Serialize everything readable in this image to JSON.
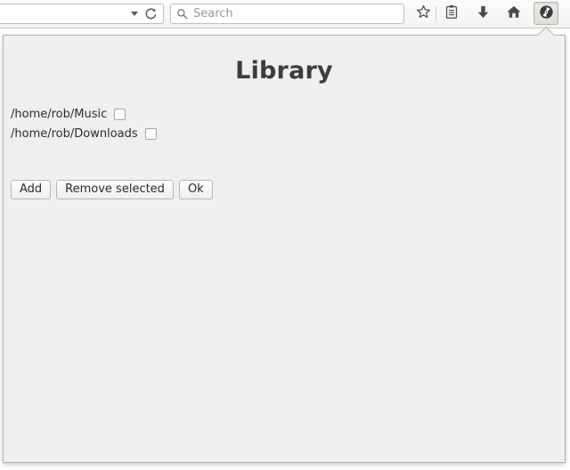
{
  "toolbar": {
    "urlbar": {
      "value": "",
      "placeholder": ""
    },
    "urlbar_dropdown_icon": "chevron-down-icon",
    "reload_icon": "reload-icon",
    "search": {
      "value": "",
      "placeholder": "Search",
      "icon": "search-icon"
    },
    "actions": [
      {
        "name": "bookmark-button",
        "icon": "star-icon",
        "active": false
      },
      {
        "name": "library-button",
        "icon": "library-icon",
        "active": false
      },
      {
        "name": "downloads-button",
        "icon": "download-arrow-icon",
        "active": false
      },
      {
        "name": "home-button",
        "icon": "home-icon",
        "active": false
      },
      {
        "name": "media-panel-button",
        "icon": "disc-icon",
        "active": true
      }
    ]
  },
  "panel": {
    "title": "Library",
    "items": [
      {
        "path": "/home/rob/Music",
        "checked": false
      },
      {
        "path": "/home/rob/Downloads",
        "checked": false
      }
    ],
    "buttons": [
      {
        "name": "add-button",
        "label": "Add"
      },
      {
        "name": "remove-selected-button",
        "label": "Remove selected"
      },
      {
        "name": "ok-button",
        "label": "Ok"
      }
    ]
  },
  "colors": {
    "toolbar_bg": "#f6f5f3",
    "panel_bg": "#f0efed",
    "panel_border": "#b6b3af",
    "title_text": "#3d3d3d",
    "body_text": "#2d2d2d",
    "placeholder_text": "#9b9894"
  }
}
